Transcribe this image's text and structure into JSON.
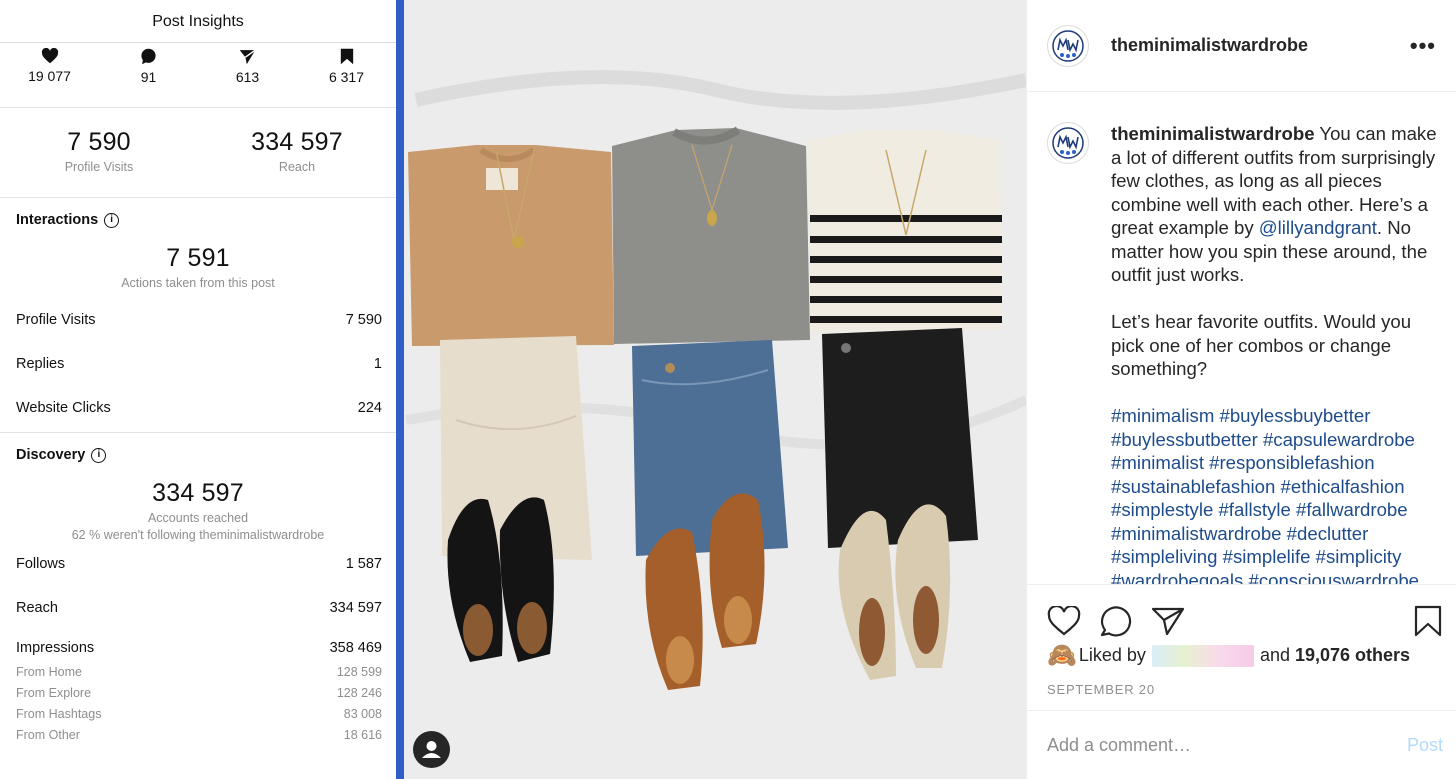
{
  "insights": {
    "title": "Post Insights",
    "top_stats": [
      {
        "icon": "heart-icon",
        "value": "19 077"
      },
      {
        "icon": "comment-icon",
        "value": "91"
      },
      {
        "icon": "share-icon",
        "value": "613"
      },
      {
        "icon": "bookmark-icon",
        "value": "6 317"
      }
    ],
    "profile_visits": {
      "value": "7 590",
      "label": "Profile Visits"
    },
    "reach": {
      "value": "334 597",
      "label": "Reach"
    },
    "interactions": {
      "heading": "Interactions",
      "total": "7 591",
      "total_label": "Actions taken from this post",
      "rows": [
        {
          "label": "Profile Visits",
          "value": "7 590"
        },
        {
          "label": "Replies",
          "value": "1"
        },
        {
          "label": "Website Clicks",
          "value": "224"
        }
      ]
    },
    "discovery": {
      "heading": "Discovery",
      "total": "334 597",
      "total_label": "Accounts reached",
      "note": "62 % weren't following theminimalistwardrobe",
      "rows": [
        {
          "label": "Follows",
          "value": "1 587"
        },
        {
          "label": "Reach",
          "value": "334 597"
        },
        {
          "label": "Impressions",
          "value": "358 469"
        }
      ],
      "sub_rows": [
        {
          "label": "From Home",
          "value": "128 599"
        },
        {
          "label": "From Explore",
          "value": "128 246"
        },
        {
          "label": "From Hashtags",
          "value": "83 008"
        },
        {
          "label": "From Other",
          "value": "18 616"
        }
      ]
    }
  },
  "post": {
    "username": "theminimalistwardrobe",
    "caption_text_1": "You can make a lot of different outfits from surprisingly few clothes, as long as all pieces combine well with each other. Here’s a great example by ",
    "mention": "@lillyandgrant",
    "caption_text_2": ". No matter how you spin these around, the outfit just works.",
    "caption_text_3": "Let’s hear favorite outfits. Would you pick one of her combos or change something?",
    "hashtags": "#minimalism #buylessbuybetter #buylessbutbetter #capsulewardrobe #minimalist #responsiblefashion #sustainablefashion #ethicalfashion #simplestyle #fallstyle #fallwardrobe #minimalistwardrobe #declutter #simpleliving #simplelife #simplicity #wardrobegoals #consciouswardrobe",
    "liked_by_prefix": "Liked by",
    "liked_by_suffix": "and",
    "liked_by_others": "19,076 others",
    "date": "SEPTEMBER 20",
    "comment_placeholder": "Add a comment…",
    "post_button": "Post"
  },
  "colors": {
    "link": "#1e4c8b",
    "post_button": "#b3dbff",
    "photo_edge": "#2e5fc8"
  }
}
